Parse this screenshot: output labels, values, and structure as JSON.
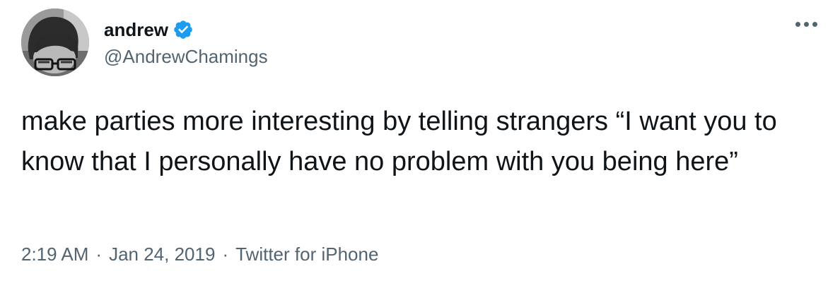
{
  "author": {
    "display_name": "andrew",
    "handle": "@AndrewChamings",
    "verified": true,
    "verified_icon": "verified-badge-icon",
    "verified_color": "#1d9bf0"
  },
  "tweet": {
    "text": "make parties more interesting by telling strangers “I want you to know that I personally have no problem with you being here”",
    "time": "2:19 AM",
    "date": "Jan 24, 2019",
    "source": "Twitter for iPhone",
    "separator": "·"
  },
  "menu": {
    "icon": "more-options-icon"
  },
  "colors": {
    "text": "#0f1419",
    "secondary": "#536471",
    "background": "#ffffff"
  }
}
